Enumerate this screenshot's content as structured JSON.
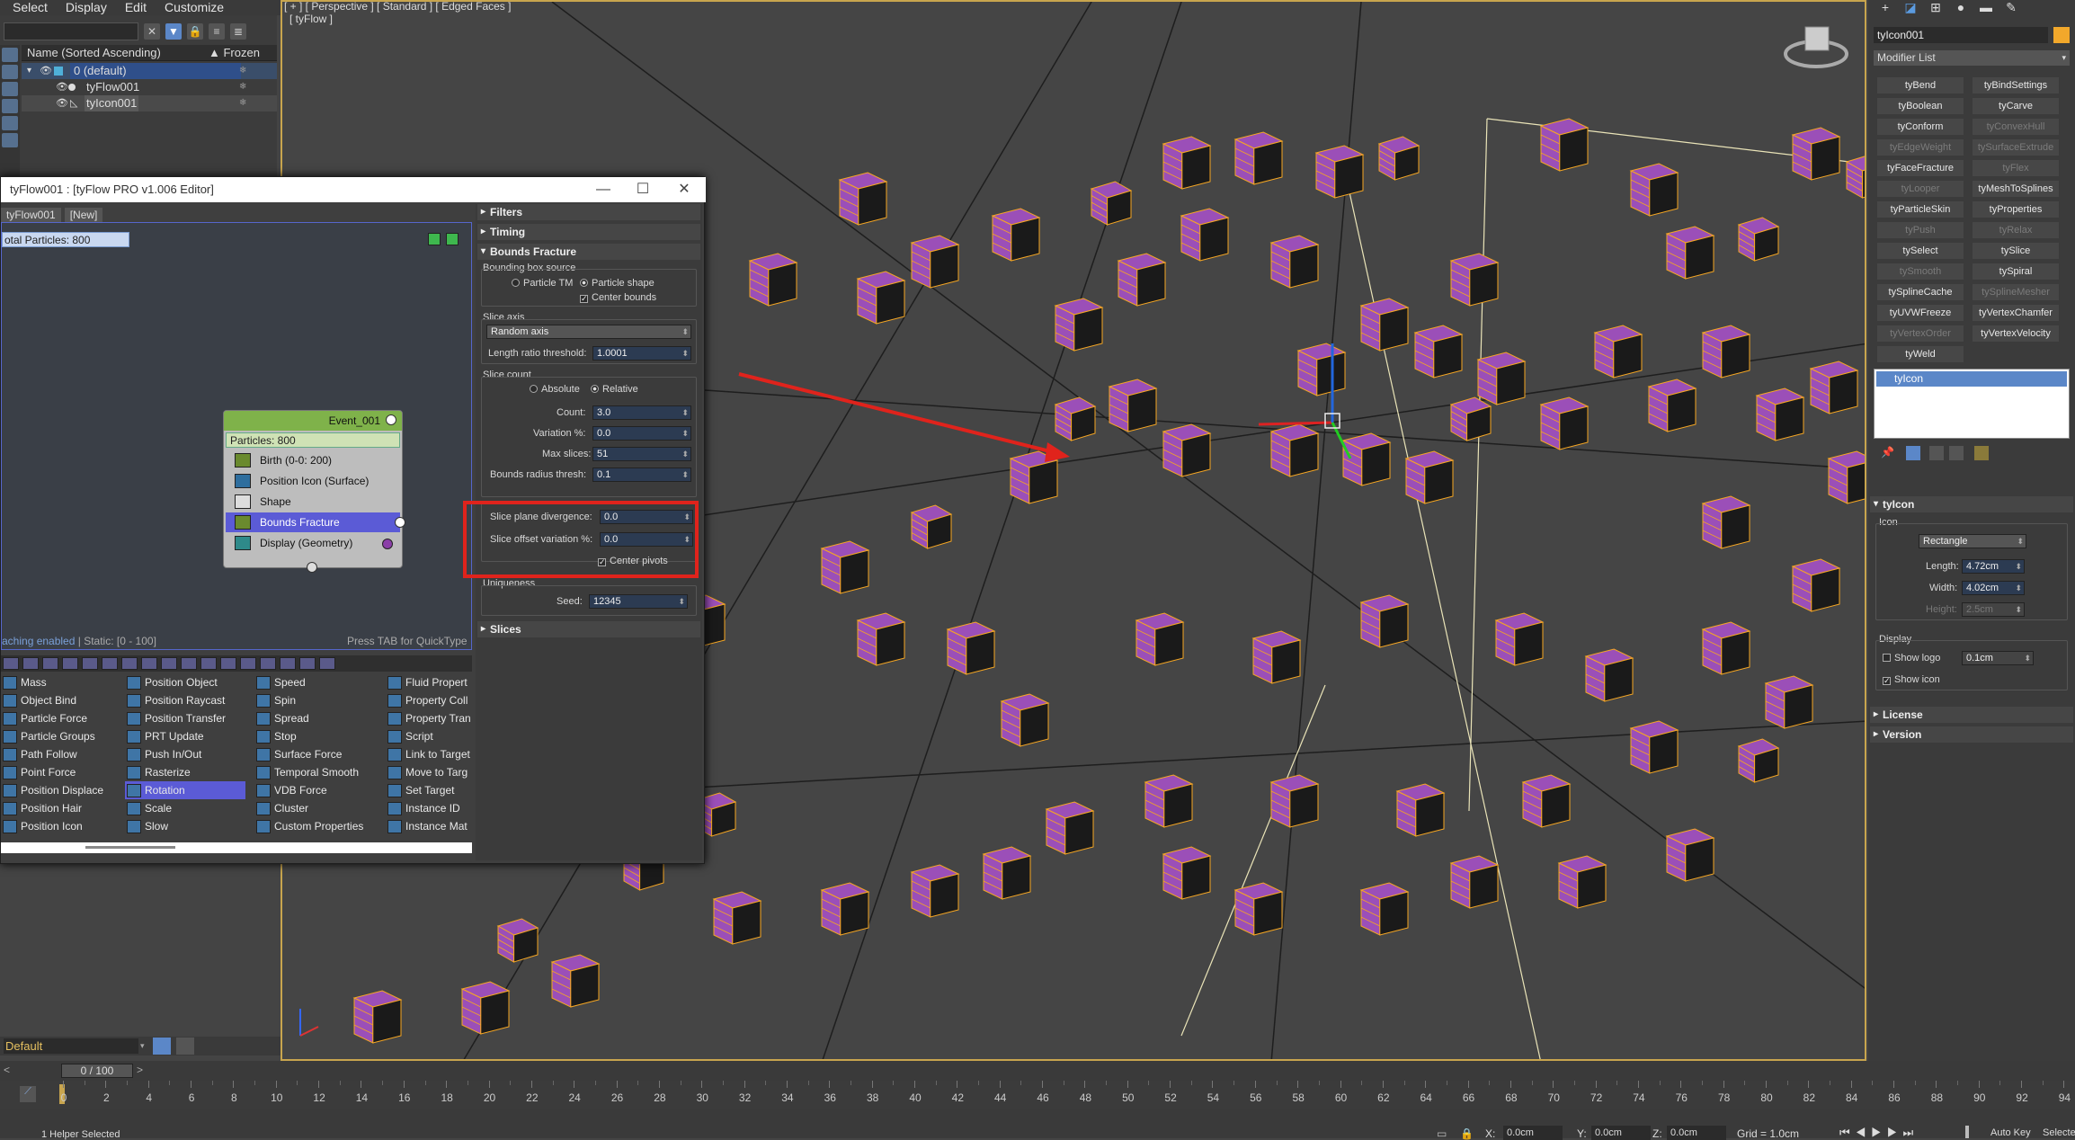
{
  "menu": [
    "Select",
    "Display",
    "Edit",
    "Customize"
  ],
  "explorer": {
    "column_name": "Name (Sorted Ascending)",
    "column_frozen": "▲ Frozen",
    "rows": [
      {
        "label": "0 (default)"
      },
      {
        "label": "tyFlow001"
      },
      {
        "label": "tyIcon001"
      }
    ]
  },
  "viewport": {
    "label": "[ + ] [ Perspective ] [ Standard ] [ Edged Faces ]",
    "sublabel": "[ tyFlow ]",
    "accent_color": "#c8a54e",
    "box_color": "#9b4fb8",
    "edge_color": "#f5a623"
  },
  "editor": {
    "title": "tyFlow001 : [tyFlow PRO v1.006 Editor]",
    "tabs": [
      "tyFlow001",
      "[New]"
    ],
    "total_particles": "otal Particles: 800",
    "event": {
      "name": "Event_001",
      "particles": "Particles: 800",
      "operators": [
        {
          "label": "Birth (0-0: 200)"
        },
        {
          "label": "Position Icon (Surface)"
        },
        {
          "label": "Shape"
        },
        {
          "label": "Bounds Fracture",
          "selected": true
        },
        {
          "label": "Display (Geometry)"
        }
      ]
    },
    "caching_prefix": "aching enabled",
    "caching_suffix": " | Static: [0 - 100]",
    "press_tab": "Press TAB for QuickType",
    "palette": {
      "col1": [
        "Mass",
        "Object Bind",
        "Particle Force",
        "Particle Groups",
        "Path Follow",
        "Point Force",
        "Position Displace",
        "Position Hair",
        "Position Icon"
      ],
      "col2": [
        "Position Object",
        "Position Raycast",
        "Position Transfer",
        "PRT Update",
        "Push In/Out",
        "Rasterize",
        "Rotation",
        "Scale",
        "Slow"
      ],
      "col3": [
        "Speed",
        "Spin",
        "Spread",
        "Stop",
        "Surface Force",
        "Temporal Smooth",
        "VDB Force",
        "Cluster",
        "Custom Properties"
      ],
      "col4": [
        "Fluid Propert",
        "Property Coll",
        "Property Tran",
        "Script",
        "Link to Target",
        "Move to Targ",
        "Set Target",
        "Instance ID",
        "Instance Mat"
      ],
      "selected": "Rotation"
    }
  },
  "settings": {
    "sections": {
      "filters": "Filters",
      "timing": "Timing",
      "bounds": "Bounds Fracture",
      "slices": "Slices"
    },
    "bbox_source": "Bounding box source",
    "particle_tm": "Particle TM",
    "particle_shape": "Particle shape",
    "center_bounds": "Center bounds",
    "slice_axis": "Slice axis",
    "slice_axis_value": "Random axis",
    "length_ratio_label": "Length ratio threshold:",
    "length_ratio_value": "1.0001",
    "slice_count": "Slice count",
    "absolute": "Absolute",
    "relative": "Relative",
    "count_label": "Count:",
    "count_value": "3.0",
    "variation_label": "Variation %:",
    "variation_value": "0.0",
    "max_slices_label": "Max slices:",
    "max_slices_value": "51",
    "bounds_radius_label": "Bounds radius thresh:",
    "bounds_radius_value": "0.1",
    "plane_div_label": "Slice plane divergence:",
    "plane_div_value": "0.0",
    "offset_var_label": "Slice offset variation %:",
    "offset_var_value": "0.0",
    "center_pivots": "Center pivots",
    "uniqueness": "Uniqueness",
    "seed_label": "Seed:",
    "seed_value": "12345"
  },
  "command_panel": {
    "object_name": "tyIcon001",
    "object_color": "#f2a82b",
    "modifier_list": "Modifier List",
    "modifiers": [
      {
        "label": "tyBend",
        "dim": false
      },
      {
        "label": "tyBindSettings",
        "dim": false
      },
      {
        "label": "tyBoolean",
        "dim": false
      },
      {
        "label": "tyCarve",
        "dim": false
      },
      {
        "label": "tyConform",
        "dim": false
      },
      {
        "label": "tyConvexHull",
        "dim": true
      },
      {
        "label": "tyEdgeWeight",
        "dim": true
      },
      {
        "label": "tySurfaceExtrude",
        "dim": true
      },
      {
        "label": "tyFaceFracture",
        "dim": false
      },
      {
        "label": "tyFlex",
        "dim": true
      },
      {
        "label": "tyLooper",
        "dim": true
      },
      {
        "label": "tyMeshToSplines",
        "dim": false
      },
      {
        "label": "tyParticleSkin",
        "dim": false
      },
      {
        "label": "tyProperties",
        "dim": false
      },
      {
        "label": "tyPush",
        "dim": true
      },
      {
        "label": "tyRelax",
        "dim": true
      },
      {
        "label": "tySelect",
        "dim": false
      },
      {
        "label": "tySlice",
        "dim": false
      },
      {
        "label": "tySmooth",
        "dim": true
      },
      {
        "label": "tySpiral",
        "dim": false
      },
      {
        "label": "tySplineCache",
        "dim": false
      },
      {
        "label": "tySplineMesher",
        "dim": true
      },
      {
        "label": "tyUVWFreeze",
        "dim": false
      },
      {
        "label": "tyVertexChamfer",
        "dim": false
      },
      {
        "label": "tyVertexOrder",
        "dim": true
      },
      {
        "label": "tyVertexVelocity",
        "dim": false
      },
      {
        "label": "tyWeld",
        "dim": false
      }
    ],
    "stack_item": "tyIcon",
    "rollout_title": "tyIcon",
    "icon_label": "Icon",
    "icon_type": "Rectangle",
    "length_label": "Length:",
    "length_value": "4.72cm",
    "width_label": "Width:",
    "width_value": "4.02cm",
    "height_label": "Height:",
    "height_value": "2.5cm",
    "display_label": "Display",
    "show_logo": "Show logo",
    "show_logo_value": "0.1cm",
    "show_icon": "Show icon",
    "license": "License",
    "version": "Version"
  },
  "layer": {
    "name": "Default"
  },
  "timeline": {
    "frame": "0 / 100",
    "ticks": [
      "0",
      "2",
      "4",
      "6",
      "8",
      "10",
      "12",
      "14",
      "16",
      "18",
      "20",
      "22",
      "24",
      "26",
      "28",
      "30",
      "32",
      "34",
      "36",
      "38",
      "40",
      "42",
      "44",
      "46",
      "48",
      "50",
      "52",
      "54",
      "56",
      "58",
      "60",
      "62",
      "64",
      "66",
      "68",
      "70",
      "72",
      "74",
      "76",
      "78",
      "80",
      "82",
      "84",
      "86",
      "88",
      "90",
      "92",
      "94"
    ]
  },
  "status": {
    "selected": "1 Helper Selected",
    "x_label": "X:",
    "x_value": "0.0cm",
    "y_label": "Y:",
    "y_value": "0.0cm",
    "z_label": "Z:",
    "z_value": "0.0cm",
    "grid": "Grid = 1.0cm",
    "auto_key": "Auto Key",
    "selected_btn": "Selecte"
  }
}
